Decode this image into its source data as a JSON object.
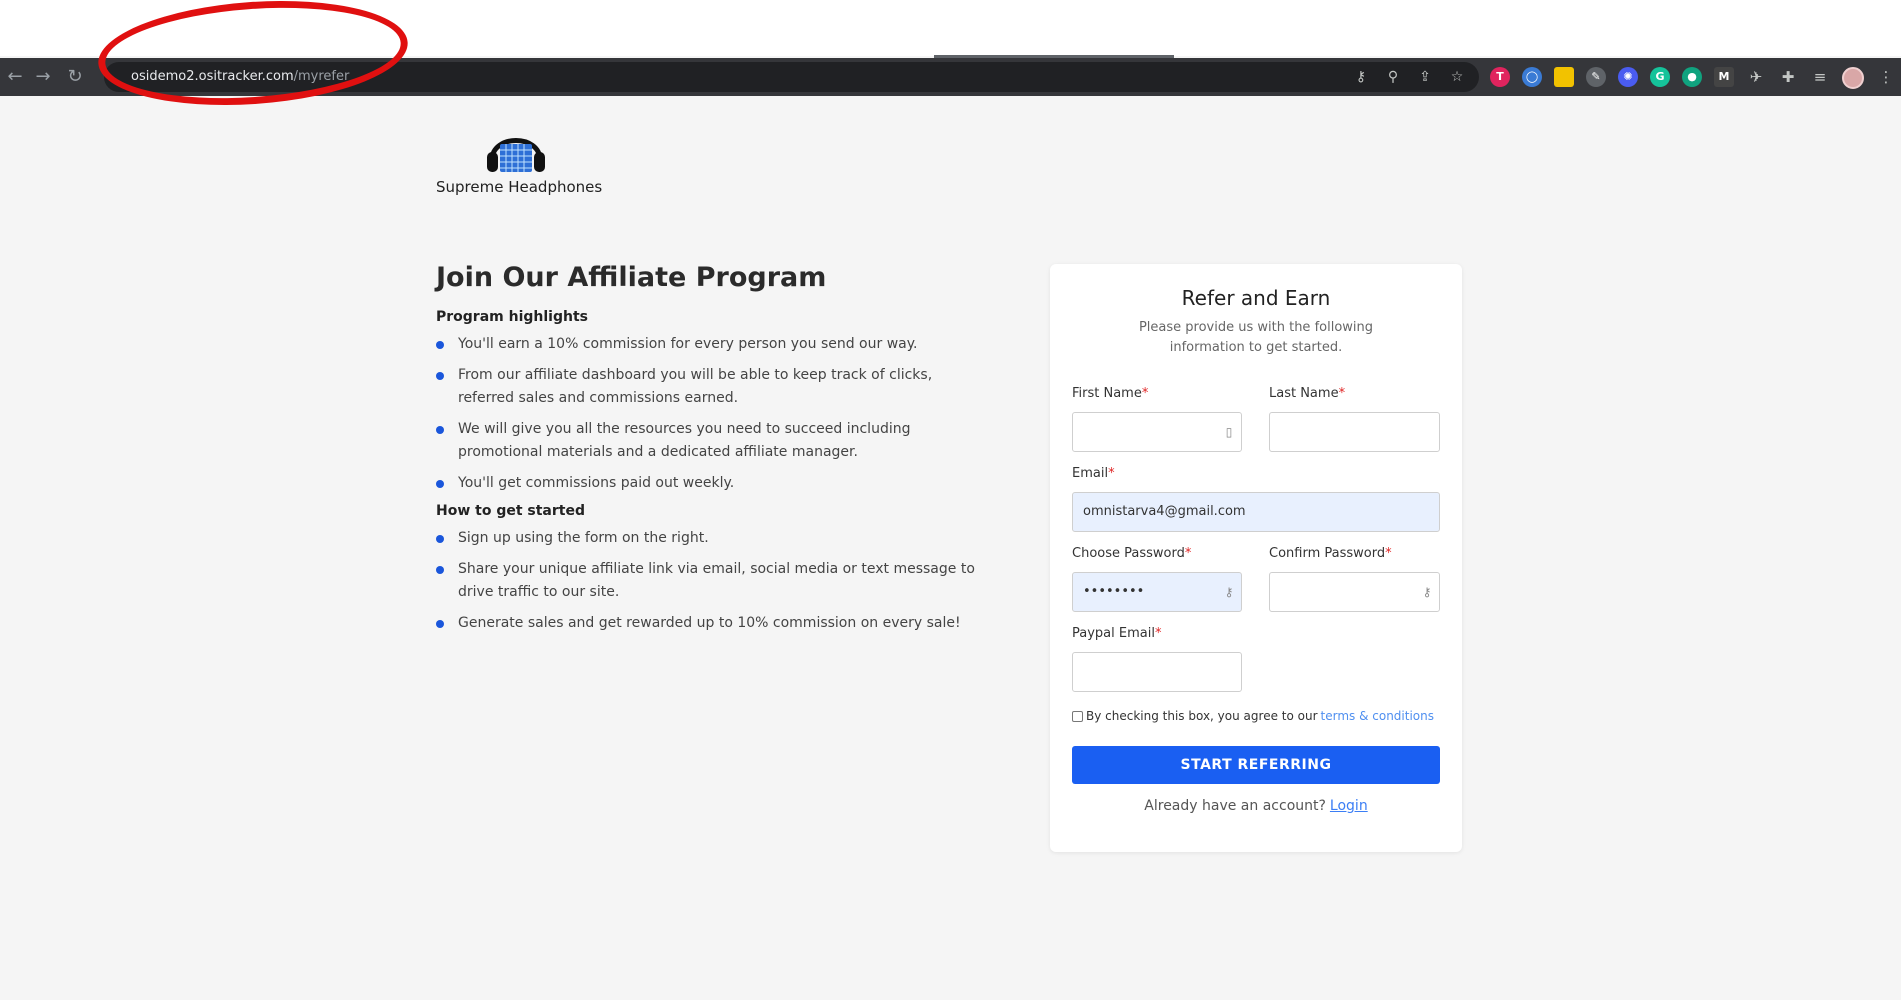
{
  "browser": {
    "url_domain": "osidemo2.ositracker.com",
    "url_path": "/myrefer"
  },
  "brand": {
    "name": "Supreme Headphones"
  },
  "intro": {
    "title": "Join Our Affiliate Program",
    "highlights_heading": "Program highlights",
    "highlights": [
      "You'll earn a 10% commission for every person you send our way.",
      "From our affiliate dashboard you will be able to keep track of clicks, referred sales and commissions earned.",
      "We will give you all the resources you need to succeed including promotional materials and a dedicated affiliate manager.",
      "You'll get commissions paid out weekly."
    ],
    "started_heading": "How to get started",
    "steps": [
      "Sign up using the form on the right.",
      "Share your unique affiliate link via email, social media or text message to drive traffic to our site.",
      "Generate sales and get rewarded up to 10% commission on every sale!"
    ]
  },
  "form": {
    "title": "Refer and Earn",
    "subtitle": "Please provide us with the following information to get started.",
    "first_name_label": "First Name",
    "last_name_label": "Last Name",
    "email_label": "Email",
    "email_value": "omnistarva4@gmail.com",
    "password_label": "Choose Password",
    "password_value": "••••••••",
    "confirm_label": "Confirm Password",
    "paypal_label": "Paypal Email",
    "required_mark": "*",
    "terms_text": "By checking this box, you agree to our",
    "terms_link": "terms & conditions",
    "submit_label": "START REFERRING",
    "already_text": "Already have an account?",
    "login_link": "Login"
  },
  "colors": {
    "accent": "#1a5ff2",
    "bullet": "#1a56db",
    "annotation": "#e01010"
  }
}
